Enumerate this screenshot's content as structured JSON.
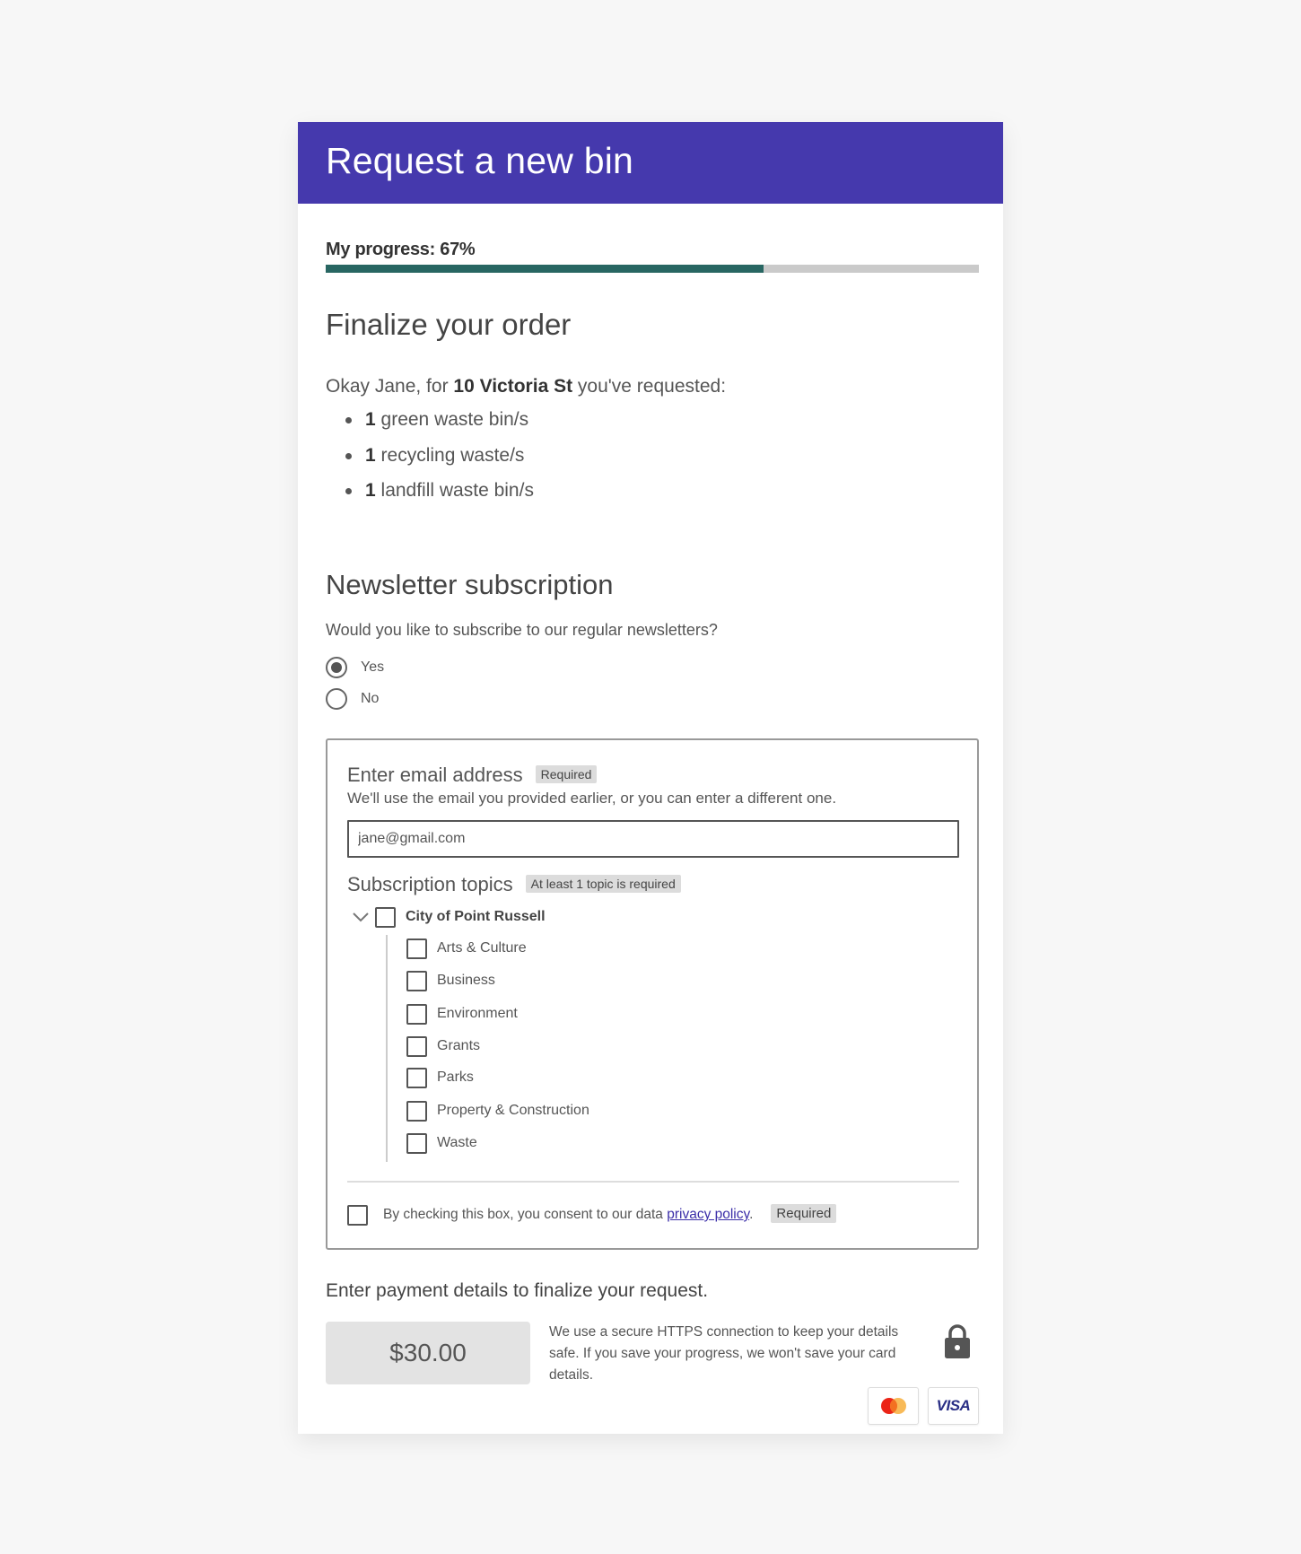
{
  "header": {
    "title": "Request a new bin"
  },
  "progress": {
    "label": "My progress: 67%",
    "value": 0.67
  },
  "order": {
    "heading": "Finalize your order",
    "intro_prefix": "Okay Jane, for ",
    "address": "10 Victoria St",
    "intro_suffix": " you've requested:",
    "items": [
      {
        "qty": "1",
        "label": " green waste bin/s"
      },
      {
        "qty": "1",
        "label": " recycling waste/s"
      },
      {
        "qty": "1",
        "label": " landfill waste bin/s"
      }
    ]
  },
  "newsletter": {
    "heading": "Newsletter subscription",
    "question": "Would you like to subscribe to our regular newsletters?",
    "options": [
      {
        "label": "Yes",
        "selected": true
      },
      {
        "label": "No",
        "selected": false
      }
    ],
    "email": {
      "label": "Enter email address",
      "badge": "Required",
      "description": "We'll use the email you provided earlier, or you can enter a different one.",
      "value": "jane@gmail.com"
    },
    "topics": {
      "label": "Subscription topics",
      "badge": "At least 1 topic is required",
      "parent": {
        "label": "City of Point Russell",
        "checked": false,
        "expanded": true
      },
      "children": [
        {
          "label": "Arts & Culture",
          "checked": false
        },
        {
          "label": "Business",
          "checked": false
        },
        {
          "label": "Environment",
          "checked": false
        },
        {
          "label": "Grants",
          "checked": false
        },
        {
          "label": "Parks",
          "checked": false
        },
        {
          "label": "Property & Construction",
          "checked": false
        },
        {
          "label": "Waste",
          "checked": false
        }
      ]
    },
    "consent": {
      "text_prefix": "By checking this box, you consent to our data ",
      "link": "privacy policy",
      "text_suffix": ".",
      "badge": "Required",
      "checked": false
    }
  },
  "payment": {
    "heading": "Enter payment details to finalize your request.",
    "amount": "$30.00",
    "secure_text": "We use a secure HTTPS connection to keep your details safe. If you save your progress, we won't save your card details.",
    "lock_icon": "lock-icon",
    "cards": [
      {
        "name": "mastercard",
        "icon": "mastercard-icon"
      },
      {
        "name": "visa",
        "label": "VISA",
        "icon": "visa-icon"
      }
    ]
  },
  "colors": {
    "header_bg": "#4539ad",
    "progress_fill": "#286662",
    "progress_track": "#cacaca",
    "link": "#3b2ea8",
    "page_bg": "#f7f7f7"
  }
}
